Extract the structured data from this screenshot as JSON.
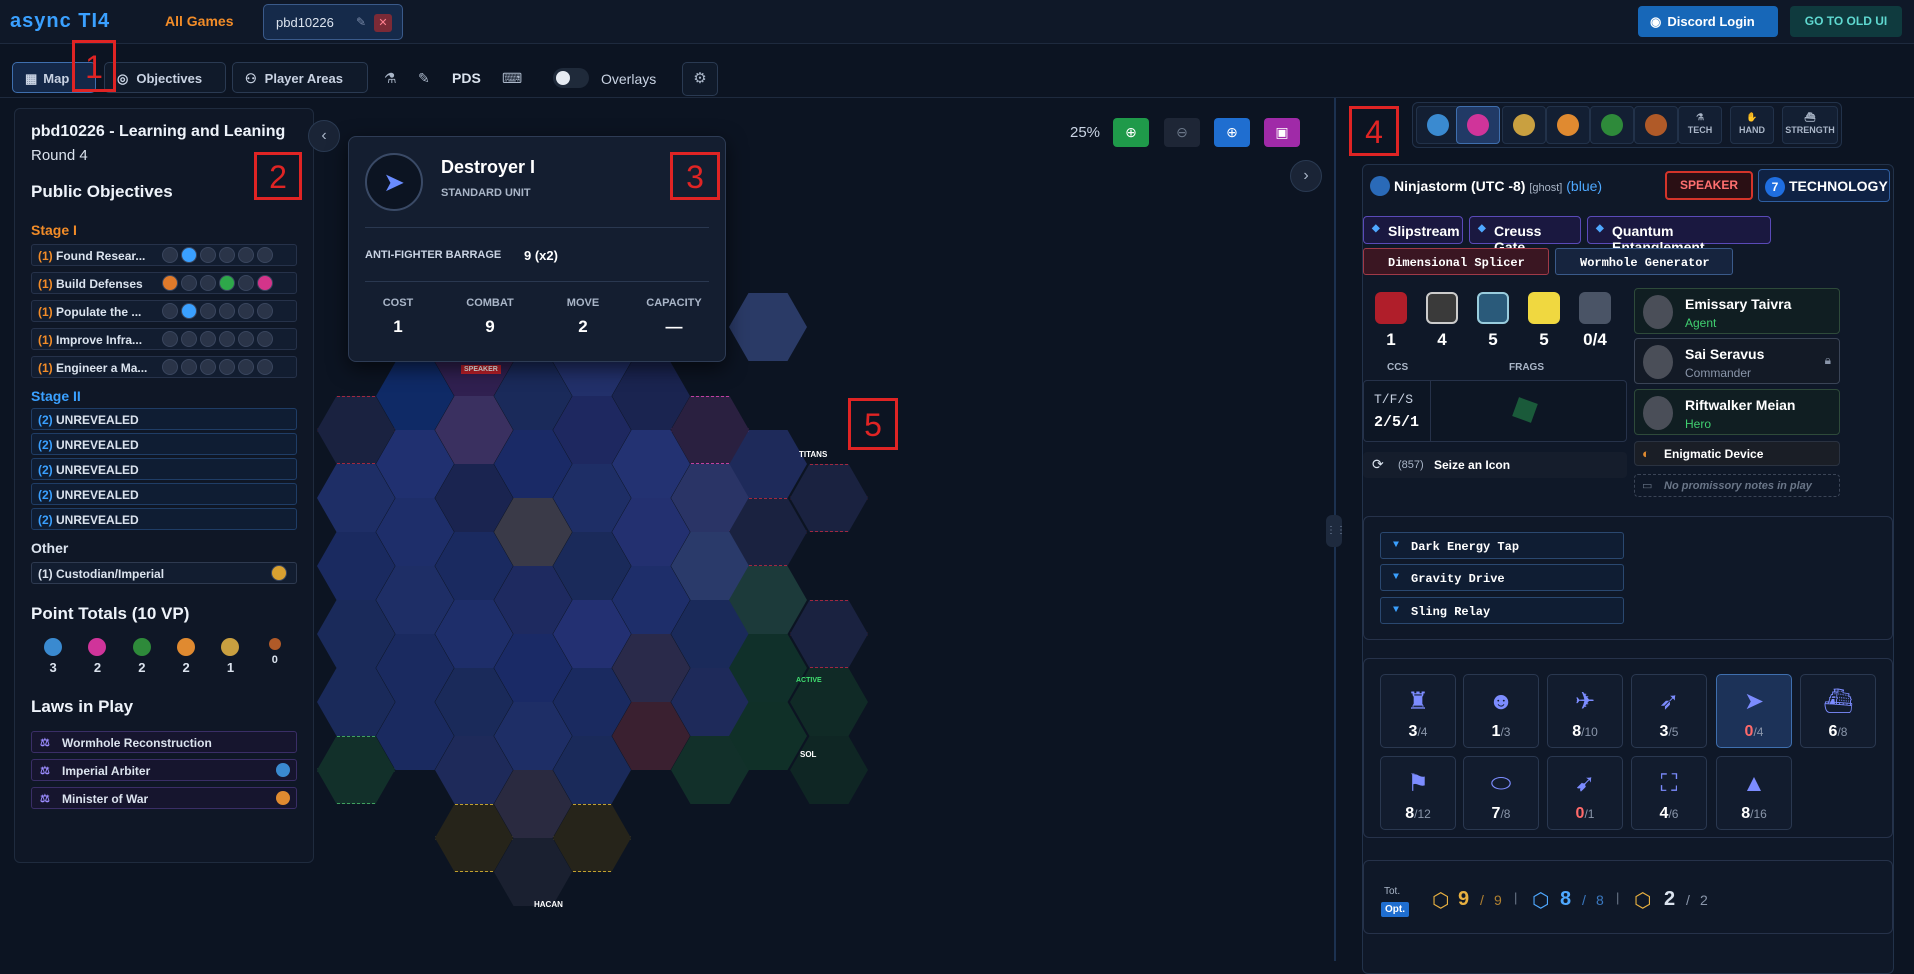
{
  "header": {
    "logo": "async TI4",
    "all_games": "All Games",
    "game_tab": "pbd10226",
    "discord": "Discord Login",
    "old_ui": "GO TO OLD UI"
  },
  "nav": {
    "map": "Map",
    "objectives": "Objectives",
    "player_areas": "Player Areas",
    "pds": "PDS",
    "overlays": "Overlays"
  },
  "markers": [
    "1",
    "2",
    "3",
    "4",
    "5"
  ],
  "left": {
    "title": "pbd10226 - Learning and Leaning",
    "round": "Round 4",
    "public_objectives": "Public Objectives",
    "stage1_label": "Stage I",
    "stage1": [
      {
        "n": "(1)",
        "label": "Found Resear..."
      },
      {
        "n": "(1)",
        "label": "Build Defenses"
      },
      {
        "n": "(1)",
        "label": "Populate the ..."
      },
      {
        "n": "(1)",
        "label": "Improve Infra..."
      },
      {
        "n": "(1)",
        "label": "Engineer a Ma..."
      }
    ],
    "stage2_label": "Stage II",
    "stage2": [
      {
        "n": "(2)",
        "label": "UNREVEALED"
      },
      {
        "n": "(2)",
        "label": "UNREVEALED"
      },
      {
        "n": "(2)",
        "label": "UNREVEALED"
      },
      {
        "n": "(2)",
        "label": "UNREVEALED"
      },
      {
        "n": "(2)",
        "label": "UNREVEALED"
      }
    ],
    "other_label": "Other",
    "other": {
      "n": "(1)",
      "label": "Custodian/Imperial"
    },
    "point_totals": "Point Totals (10 VP)",
    "points": [
      "3",
      "2",
      "2",
      "2",
      "1",
      "0"
    ],
    "laws_label": "Laws in Play",
    "laws": [
      "Wormhole Reconstruction",
      "Imperial Arbiter",
      "Minister of War"
    ]
  },
  "map": {
    "zoom": "25%",
    "hex_labels": [
      "TITANS",
      "SOL",
      "HACAN",
      "ACTIVE",
      "SPEAKER"
    ]
  },
  "tooltip": {
    "name": "Destroyer I",
    "type": "STANDARD UNIT",
    "ability": "ANTI-FIGHTER BARRAGE",
    "ability_value": "9 (x2)",
    "stats": [
      {
        "h": "COST",
        "v": "1"
      },
      {
        "h": "COMBAT",
        "v": "9"
      },
      {
        "h": "MOVE",
        "v": "2"
      },
      {
        "h": "CAPACITY",
        "v": "—"
      }
    ]
  },
  "right": {
    "tabs": [
      "TECH",
      "HAND",
      "STRENGTH"
    ],
    "player": "Ninjastorm (UTC -8)",
    "ghost": "[ghost]",
    "color": "(blue)",
    "speaker": "SPEAKER",
    "tech_num": "7",
    "tech_label": "TECHNOLOGY",
    "abilities": [
      "Slipstream",
      "Creuss Gate",
      "Quantum Entanglement"
    ],
    "relics": [
      "Dimensional Splicer",
      "Wormhole Generator"
    ],
    "tokens": [
      "1",
      "4",
      "5",
      "5",
      "0/4"
    ],
    "ccs": "CCS",
    "frags": "FRAGS",
    "tfs_label": "T/F/S",
    "tfs": "2/5/1",
    "seize": "(857)",
    "seize_label": "Seize an Icon",
    "leaders": [
      {
        "name": "Emissary Taivra",
        "role": "Agent"
      },
      {
        "name": "Sai Seravus",
        "role": "Commander"
      },
      {
        "name": "Riftwalker Meian",
        "role": "Hero"
      }
    ],
    "device": "Enigmatic Device",
    "no_pn": "No promissory notes in play",
    "techs": [
      "Dark Energy Tap",
      "Gravity Drive",
      "Sling Relay"
    ],
    "units_row1": [
      {
        "c": "3",
        "m": "/4"
      },
      {
        "c": "1",
        "m": "/3"
      },
      {
        "c": "8",
        "m": "/10"
      },
      {
        "c": "3",
        "m": "/5"
      },
      {
        "c": "0",
        "m": "/4"
      },
      {
        "c": "6",
        "m": "/8"
      }
    ],
    "units_row2": [
      {
        "c": "8",
        "m": "/12"
      },
      {
        "c": "7",
        "m": "/8"
      },
      {
        "c": "0",
        "m": "/1"
      },
      {
        "c": "4",
        "m": "/6"
      },
      {
        "c": "8",
        "m": "/16"
      }
    ],
    "totals_label": "Tot.",
    "opt_label": "Opt.",
    "totals": [
      {
        "a": "9",
        "b": "9"
      },
      {
        "a": "8",
        "b": "8"
      },
      {
        "a": "2",
        "b": "2"
      }
    ]
  },
  "colors": {
    "accent": "#3aa0ff",
    "orange": "#f28c28",
    "red": "#e02424"
  }
}
